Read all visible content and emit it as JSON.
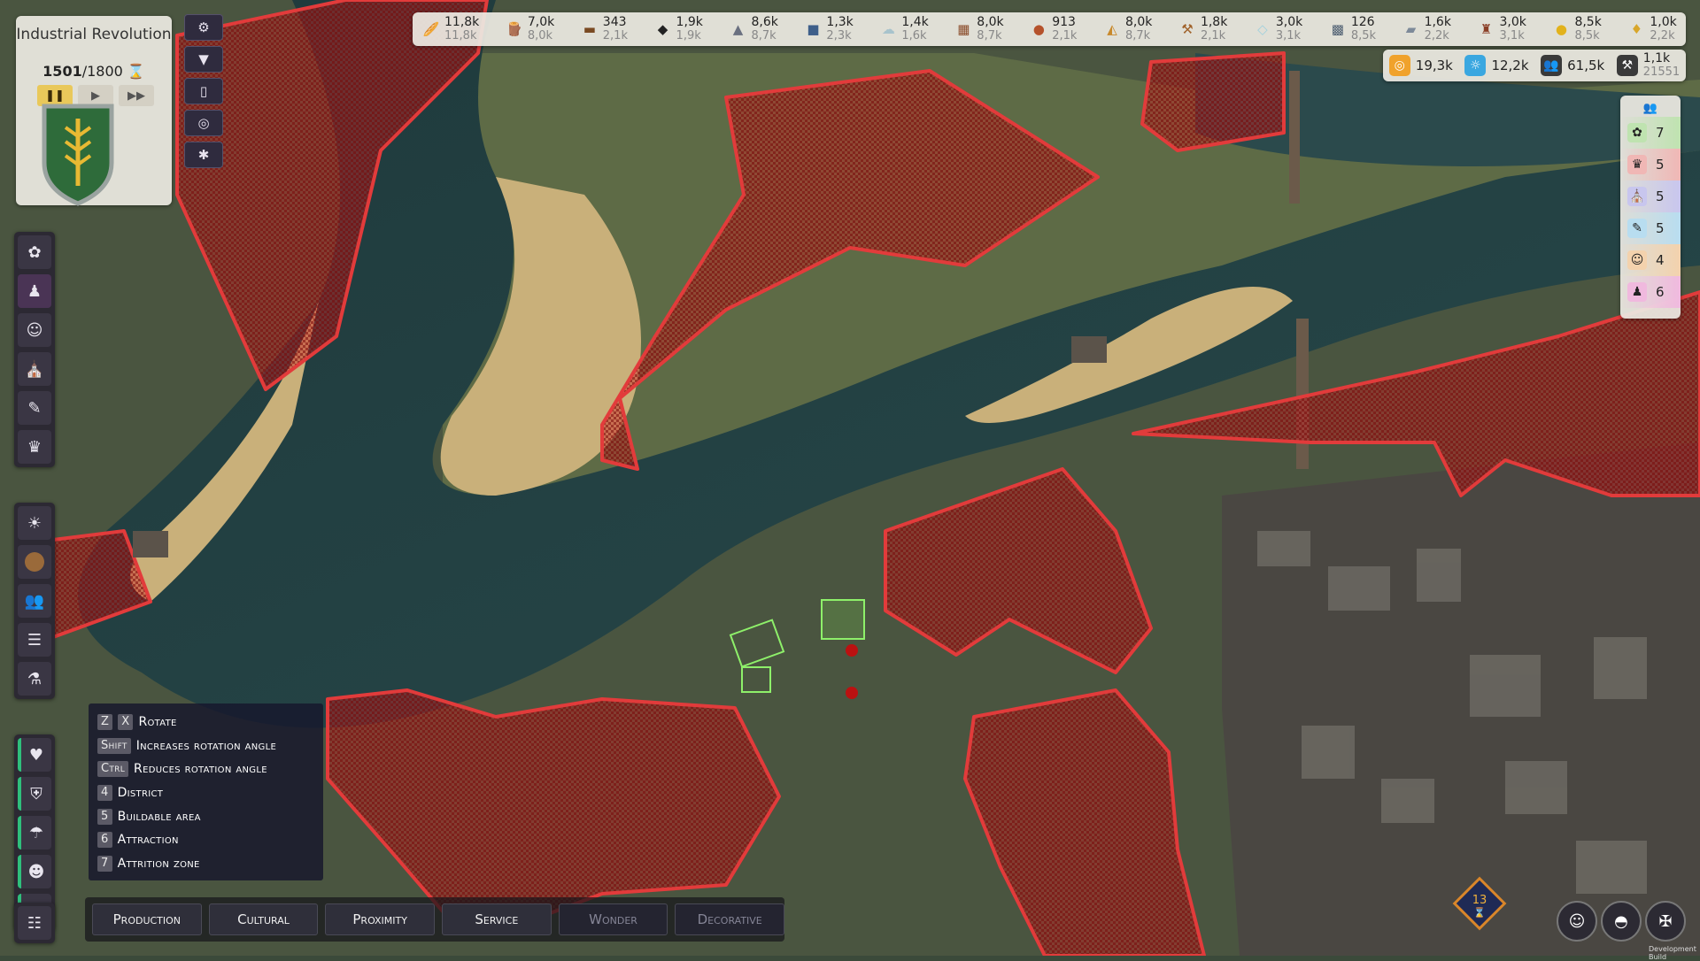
{
  "era": {
    "name": "Industrial Revolution",
    "year": "1501",
    "year_max": "/1800",
    "pause_icon": "pause-icon",
    "play_icon": "play-icon",
    "fast_icon": "fast-forward-icon"
  },
  "toolbar": [
    "gear-icon",
    "filter-icon",
    "book-icon",
    "eye-off-icon",
    "bug-icon"
  ],
  "resources": [
    {
      "icon": "food-icon",
      "value": "11,8k",
      "sub": "11,8k",
      "color": "#d89a2b"
    },
    {
      "icon": "wood-icon",
      "value": "7,0k",
      "sub": "8,0k",
      "color": "#8b5a2b"
    },
    {
      "icon": "plank-icon",
      "value": "343",
      "sub": "2,1k",
      "color": "#7a4a22"
    },
    {
      "icon": "coal-icon",
      "value": "1,9k",
      "sub": "1,9k",
      "color": "#222"
    },
    {
      "icon": "stone-icon",
      "value": "8,6k",
      "sub": "8,7k",
      "color": "#6a7080"
    },
    {
      "icon": "iron-icon",
      "value": "1,3k",
      "sub": "2,3k",
      "color": "#3e5f8a"
    },
    {
      "icon": "wool-icon",
      "value": "1,4k",
      "sub": "1,6k",
      "color": "#a8c3cc"
    },
    {
      "icon": "brick-icon",
      "value": "8,0k",
      "sub": "8,7k",
      "color": "#8a4b2a"
    },
    {
      "icon": "clay-icon",
      "value": "913",
      "sub": "2,1k",
      "color": "#b5522b"
    },
    {
      "icon": "bread-icon",
      "value": "8,0k",
      "sub": "8,7k",
      "color": "#c8892b"
    },
    {
      "icon": "tool-icon",
      "value": "1,8k",
      "sub": "2,1k",
      "color": "#a0622a"
    },
    {
      "icon": "glass-icon",
      "value": "3,0k",
      "sub": "3,1k",
      "color": "#9fd0dd"
    },
    {
      "icon": "fabric-icon",
      "value": "126",
      "sub": "8,5k",
      "color": "#4c5d70"
    },
    {
      "icon": "steel-icon",
      "value": "1,6k",
      "sub": "2,2k",
      "color": "#7d8a99"
    },
    {
      "icon": "furniture-icon",
      "value": "3,0k",
      "sub": "3,1k",
      "color": "#8a3e26"
    },
    {
      "icon": "gold-icon",
      "value": "8,5k",
      "sub": "8,5k",
      "color": "#e2b21c"
    },
    {
      "icon": "wine-icon",
      "value": "1,0k",
      "sub": "2,2k",
      "color": "#d8a62a"
    }
  ],
  "resources2": [
    {
      "icon": "coin-icon",
      "value": "19,3k",
      "bg": "#f0a22c"
    },
    {
      "icon": "science-icon",
      "value": "12,2k",
      "bg": "#3aa7e0"
    },
    {
      "icon": "population-icon",
      "value": "61,5k",
      "bg": "#3a3a3a"
    },
    {
      "icon": "workers-icon",
      "value": "1,1k",
      "sub": "21551",
      "bg": "#3a3a3a"
    }
  ],
  "stats": [
    {
      "icon": "nature-icon",
      "value": "7",
      "bg": "#bfe3b0"
    },
    {
      "icon": "culture-icon",
      "value": "5",
      "bg": "#f0b7b5"
    },
    {
      "icon": "religion-icon",
      "value": "5",
      "bg": "#c8c6ee"
    },
    {
      "icon": "education-icon",
      "value": "5",
      "bg": "#b8ddf0"
    },
    {
      "icon": "social-icon",
      "value": "4",
      "bg": "#f3d2ad"
    },
    {
      "icon": "wealth-icon",
      "value": "6",
      "bg": "#f0b9de"
    }
  ],
  "sidebar_top": [
    "nature-icon",
    "worker-icon",
    "social-icon",
    "religion-icon",
    "education-icon",
    "culture-icon"
  ],
  "sidebar_mid": [
    "sun-icon",
    "coin-icon",
    "people-icon",
    "list-icon",
    "flask-icon"
  ],
  "sidebar_low": [
    "health-icon",
    "security-icon",
    "hygiene-icon",
    "happiness-icon",
    "trade-icon"
  ],
  "sidebar_last": "advisor-icon",
  "keybinds": [
    {
      "keys": [
        "Z",
        "X"
      ],
      "label": "Rotate"
    },
    {
      "keys": [
        "Shift"
      ],
      "label": "Increases rotation angle"
    },
    {
      "keys": [
        "Ctrl"
      ],
      "label": "Reduces rotation angle"
    },
    {
      "keys": [
        "4"
      ],
      "label": "District"
    },
    {
      "keys": [
        "5"
      ],
      "label": "Buildable area"
    },
    {
      "keys": [
        "6"
      ],
      "label": "Attraction"
    },
    {
      "keys": [
        "7"
      ],
      "label": "Attrition zone"
    }
  ],
  "tabs": [
    {
      "label": "Production",
      "enabled": true
    },
    {
      "label": "Cultural",
      "enabled": true
    },
    {
      "label": "Proximity",
      "enabled": true
    },
    {
      "label": "Service",
      "enabled": true
    },
    {
      "label": "Wonder",
      "enabled": false
    },
    {
      "label": "Decorative",
      "enabled": false
    }
  ],
  "turn": {
    "value": "13",
    "icon": "hourglass-icon"
  },
  "bottom_right": [
    "advisors-icon",
    "mask-icon",
    "emblem-icon"
  ],
  "dev_label": "Development Build"
}
